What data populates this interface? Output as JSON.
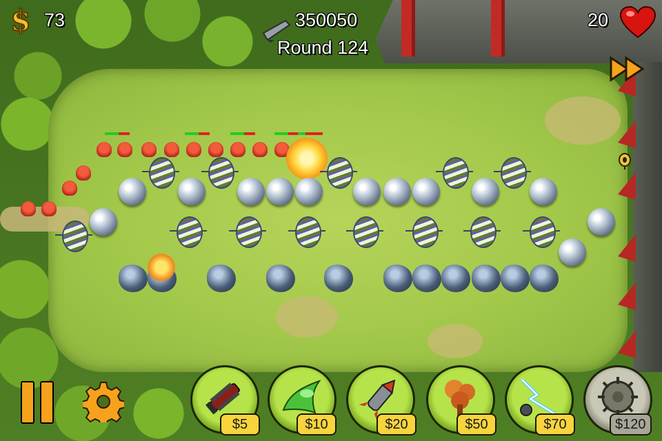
{
  "hud": {
    "money": "73",
    "score": "350050",
    "round": "Round 124",
    "lives": "20"
  },
  "icons": {
    "money": "dollar-icon",
    "lives": "heart-icon",
    "score": "gun-icon",
    "fast_forward": "fast-forward-icon",
    "pause": "pause-icon",
    "settings": "gear-icon"
  },
  "shop": [
    {
      "name": "Minigun",
      "price": "$5",
      "icon": "minigun-icon",
      "enabled": true
    },
    {
      "name": "Goo",
      "price": "$10",
      "icon": "goo-icon",
      "enabled": true
    },
    {
      "name": "Rocket",
      "price": "$20",
      "icon": "rocket-icon",
      "enabled": true
    },
    {
      "name": "Mortar",
      "price": "$50",
      "icon": "mortar-icon",
      "enabled": true
    },
    {
      "name": "Tesla",
      "price": "$70",
      "icon": "tesla-icon",
      "enabled": true
    },
    {
      "name": "Mine",
      "price": "$120",
      "icon": "mine-icon",
      "enabled": false
    }
  ],
  "colors": {
    "hud_text": "#ffffff",
    "price_tag": "#f7d43d",
    "price_tag_disabled": "#a8a699",
    "shop_active": "#b6e34a",
    "heart": "#d7140f",
    "wall_red": "#c22a25"
  }
}
